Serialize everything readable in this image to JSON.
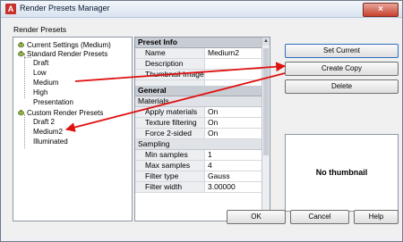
{
  "window": {
    "title": "Render Presets Manager",
    "close_label": "×",
    "app_icon_letter": "A"
  },
  "section_label": "Render Presets",
  "tree": {
    "current_settings": "Current Settings (Medium)",
    "standard_group": "Standard Render Presets",
    "standard_items": [
      "Draft",
      "Low",
      "Medium",
      "High",
      "Presentation"
    ],
    "custom_group": "Custom Render Presets",
    "custom_items": [
      "Draft 2",
      "Medium2",
      "Illuminated"
    ]
  },
  "properties": {
    "preset_info_header": "Preset Info",
    "name_label": "Name",
    "name_value": "Medium2",
    "description_label": "Description",
    "description_value": "",
    "thumbnail_label": "Thumbnail Image",
    "thumbnail_value": "",
    "general_header": "General",
    "materials_header": "Materials",
    "apply_materials_label": "Apply materials",
    "apply_materials_value": "On",
    "texture_filtering_label": "Texture filtering",
    "texture_filtering_value": "On",
    "force_2sided_label": "Force 2-sided",
    "force_2sided_value": "On",
    "sampling_header": "Sampling",
    "min_samples_label": "Min samples",
    "min_samples_value": "1",
    "max_samples_label": "Max samples",
    "max_samples_value": "4",
    "filter_type_label": "Filter type",
    "filter_type_value": "Gauss",
    "filter_width_label": "Filter width",
    "filter_width_value": "3.00000"
  },
  "buttons": {
    "set_current": "Set Current",
    "create_copy": "Create Copy",
    "delete": "Delete",
    "ok": "OK",
    "cancel": "Cancel",
    "help": "Help"
  },
  "thumbnail_text": "No thumbnail",
  "annotation_arrow_color": "#e01010"
}
